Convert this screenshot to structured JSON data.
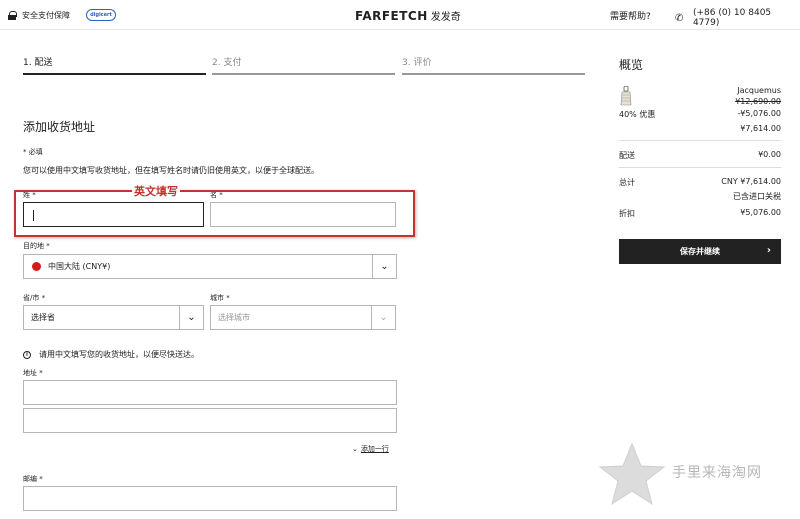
{
  "header": {
    "secure_label": "安全支付保障",
    "digicert": "digicert",
    "brand": "FARFETCH",
    "brand_cn": "发发奇",
    "help": "需要帮助?",
    "phone": "(+86 (0) 10 8405 4779)"
  },
  "steps": [
    {
      "label": "1. 配送",
      "active": true
    },
    {
      "label": "2. 支付",
      "active": false
    },
    {
      "label": "3. 评价",
      "active": false
    }
  ],
  "form": {
    "title": "添加收货地址",
    "required_note": "* 必填",
    "info_text": "您可以使用中文填写收货地址，但在填写姓名时请仍旧使用英文，以便于全球配送。",
    "annotation": "英文填写",
    "last_name_label": "姓 *",
    "first_name_label": "名 *",
    "destination_label": "目的地 *",
    "destination_value": "中国大陆 (CNY¥)",
    "province_label": "省/市 *",
    "province_value": "选择省",
    "city_label": "城市 *",
    "city_value": "选择城市",
    "hint": "请用中文填写您的收货地址，以便尽快送达。",
    "address_label": "地址 *",
    "add_line": "添加一行",
    "postal_label": "邮编 *"
  },
  "summary": {
    "title": "概览",
    "brand": "Jacquemus",
    "original_price": "¥12,690.00",
    "discount_label": "40% 优惠",
    "discount_value": "-¥5,076.00",
    "item_price": "¥7,614.00",
    "shipping_label": "配送",
    "shipping_value": "¥0.00",
    "total_label": "总计",
    "total_value": "CNY ¥7,614.00",
    "tax_note": "已含进口关税",
    "saving_label": "折扣",
    "saving_value": "¥5,076.00",
    "save_button": "保存并继续"
  },
  "watermark": "手里来海淘网",
  "icons": {
    "lock": "lock-icon",
    "phone": "phone-icon",
    "chevron": "chevron-down-icon",
    "arrow": "arrow-right-icon",
    "info": "info-icon"
  },
  "colors": {
    "accent": "#222222",
    "annotation": "#c6332c",
    "flag": "#d61a1a"
  }
}
